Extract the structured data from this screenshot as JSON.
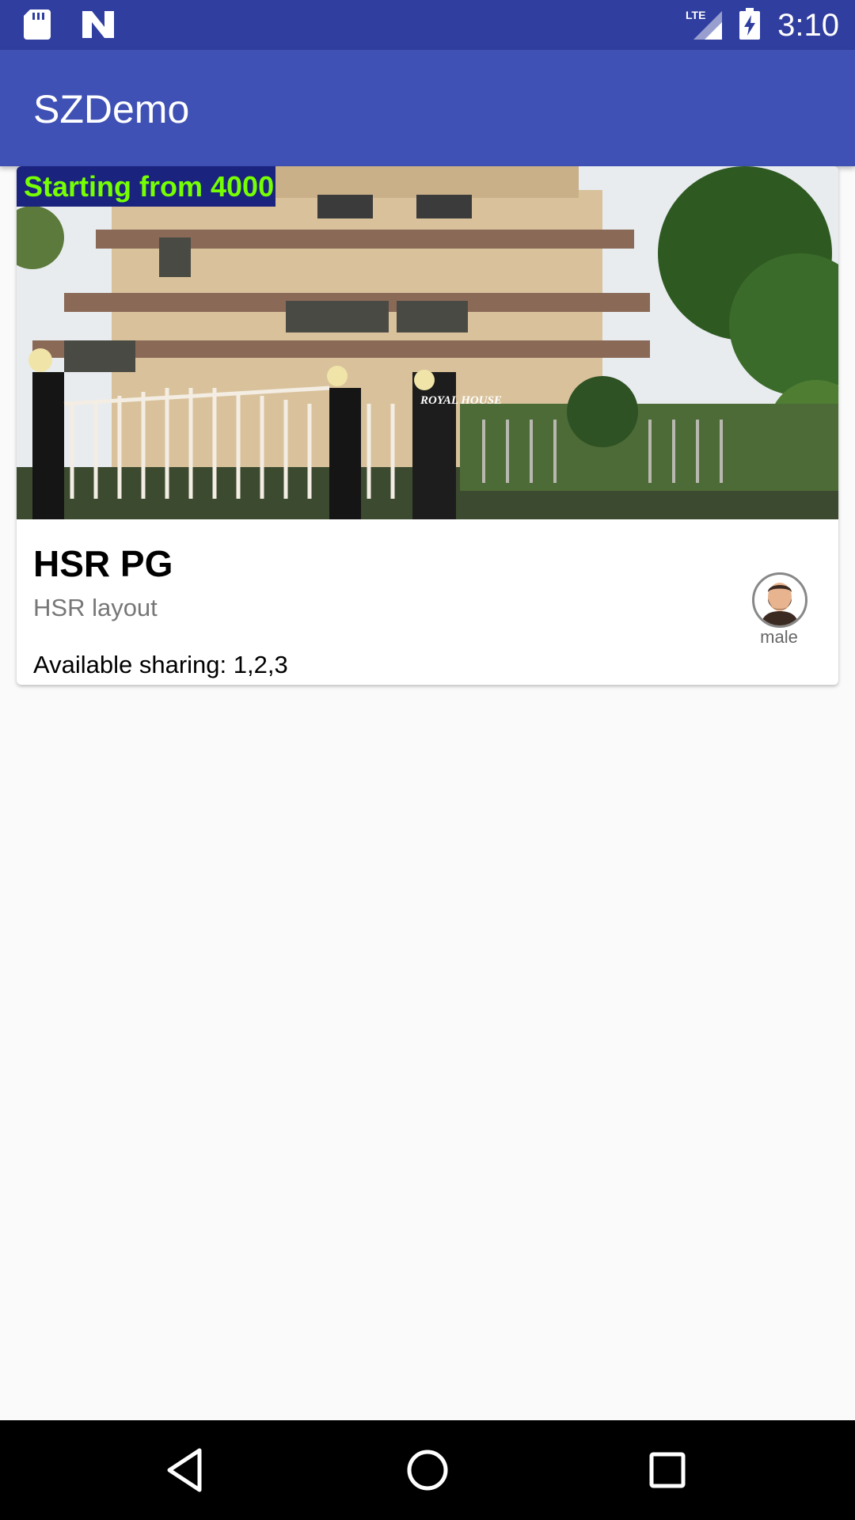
{
  "status_bar": {
    "time": "3:10",
    "network": "LTE",
    "icons": [
      "sd-card-icon",
      "n-notification-icon",
      "lte-signal-icon",
      "battery-charging-icon"
    ]
  },
  "app_bar": {
    "title": "SZDemo"
  },
  "listing": {
    "price_badge": "Starting from 4000",
    "image_sign": "ROYAL HOUSE",
    "name": "HSR PG",
    "location": "HSR layout",
    "sharing": "Available sharing: 1,2,3",
    "gender": "male"
  },
  "colors": {
    "status_bar": "#303f9f",
    "app_bar": "#3f51b5",
    "price_badge_bg": "#1a237e",
    "price_badge_text": "#76ff03",
    "nav_bar": "#000000"
  },
  "nav_bar": {
    "buttons": [
      "back-icon",
      "home-icon",
      "recents-icon"
    ]
  }
}
